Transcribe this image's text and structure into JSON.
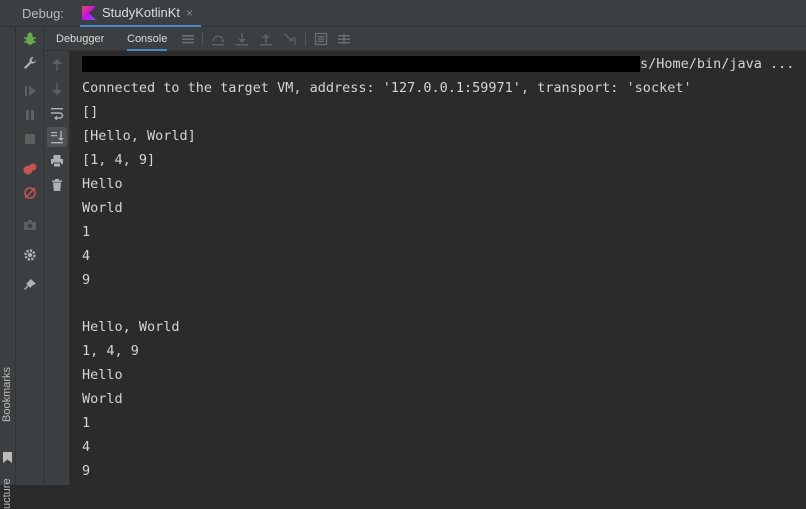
{
  "header": {
    "debug_label": "Debug:",
    "run_config": "StudyKotlinKt",
    "close_glyph": "×"
  },
  "sidebar": {
    "bookmarks_label": "Bookmarks",
    "structure_label": "ucture"
  },
  "subtabs": [
    {
      "label": "Debugger"
    },
    {
      "label": "Console"
    }
  ],
  "icons": {
    "kotlin_icon": "kotlin-icon",
    "bug_color": "#6aa84f",
    "mute_color": "#c75450"
  },
  "console": {
    "cmd_tail": "s/Home/bin/java ...",
    "lines": [
      "Connected to the target VM, address: '127.0.0.1:59971', transport: 'socket'",
      "[]",
      "[Hello, World]",
      "[1, 4, 9]",
      "Hello",
      "World",
      "1",
      "4",
      "9",
      "",
      "Hello, World",
      "1, 4, 9",
      "Hello",
      "World",
      "1",
      "4",
      "9"
    ]
  }
}
